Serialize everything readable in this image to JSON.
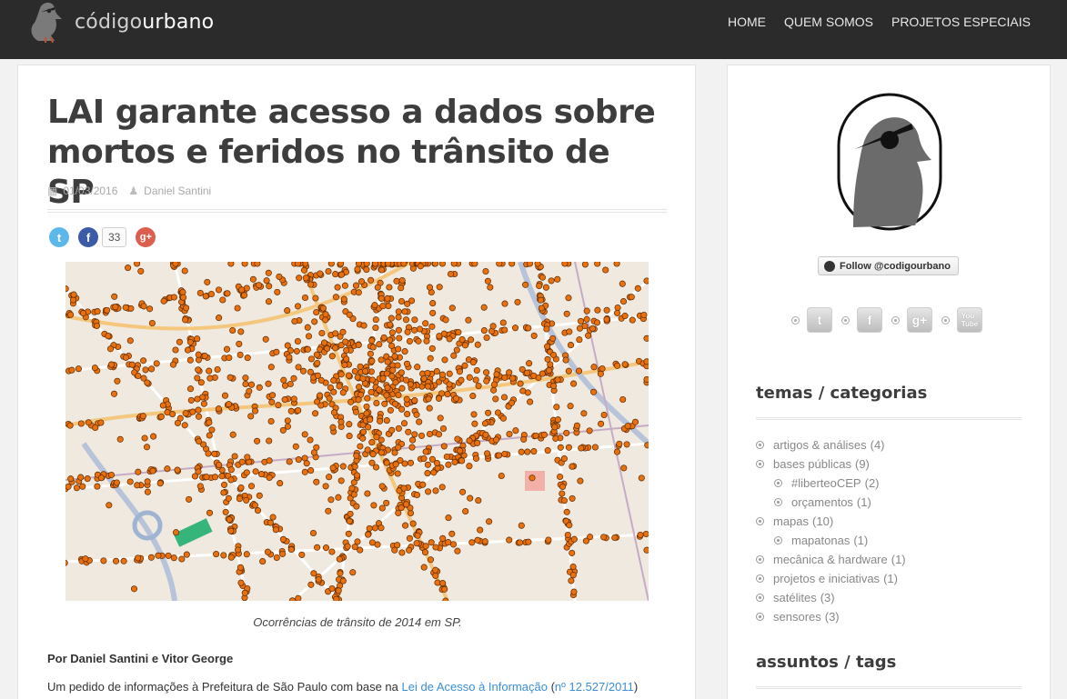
{
  "brand": {
    "name_light": "código",
    "name_bold": "urbano"
  },
  "nav": [
    "HOME",
    "QUEM SOMOS",
    "PROJETOS ESPECIAIS"
  ],
  "post": {
    "title": "LAI garante acesso a dados sobre mortos e feridos no trânsito de SP",
    "date": "01/03/2016",
    "author": "Daniel Santini",
    "share_count": "33",
    "caption": "Ocorrências de trânsito de 2014 em SP.",
    "byline": "Por Daniel Santini e Vitor George",
    "para": {
      "before": "Um pedido de informações à Prefeitura de São Paulo com base na ",
      "link1": "Lei de Acesso à Informação",
      "middle": " (",
      "link2": "nº 12.527/2011",
      "after": ")"
    }
  },
  "sidebar": {
    "follow_label": "Follow @codigourbano",
    "social_icons": [
      "twitter-icon",
      "facebook-icon",
      "googleplus-icon",
      "youtube-icon"
    ],
    "categories_title": "temas / categorias",
    "categories": [
      {
        "label": "artigos & análises",
        "count": "(4)",
        "sub": false
      },
      {
        "label": "bases públicas",
        "count": "(9)",
        "sub": false
      },
      {
        "label": "#liberteoCEP",
        "count": "(2)",
        "sub": true
      },
      {
        "label": "orçamentos",
        "count": "(1)",
        "sub": true
      },
      {
        "label": "mapas",
        "count": "(10)",
        "sub": false
      },
      {
        "label": "mapatonas",
        "count": "(1)",
        "sub": true
      },
      {
        "label": "mecânica & hardware",
        "count": "(1)",
        "sub": false
      },
      {
        "label": "projetos e iniciativas",
        "count": "(1)",
        "sub": false
      },
      {
        "label": "satélites",
        "count": "(3)",
        "sub": false
      },
      {
        "label": "sensores",
        "count": "(3)",
        "sub": false
      }
    ],
    "tags_title": "assuntos / tags"
  },
  "colors": {
    "topbar": "#2b2b2b",
    "link": "#3a8fd6",
    "marker": "#e8700e"
  }
}
